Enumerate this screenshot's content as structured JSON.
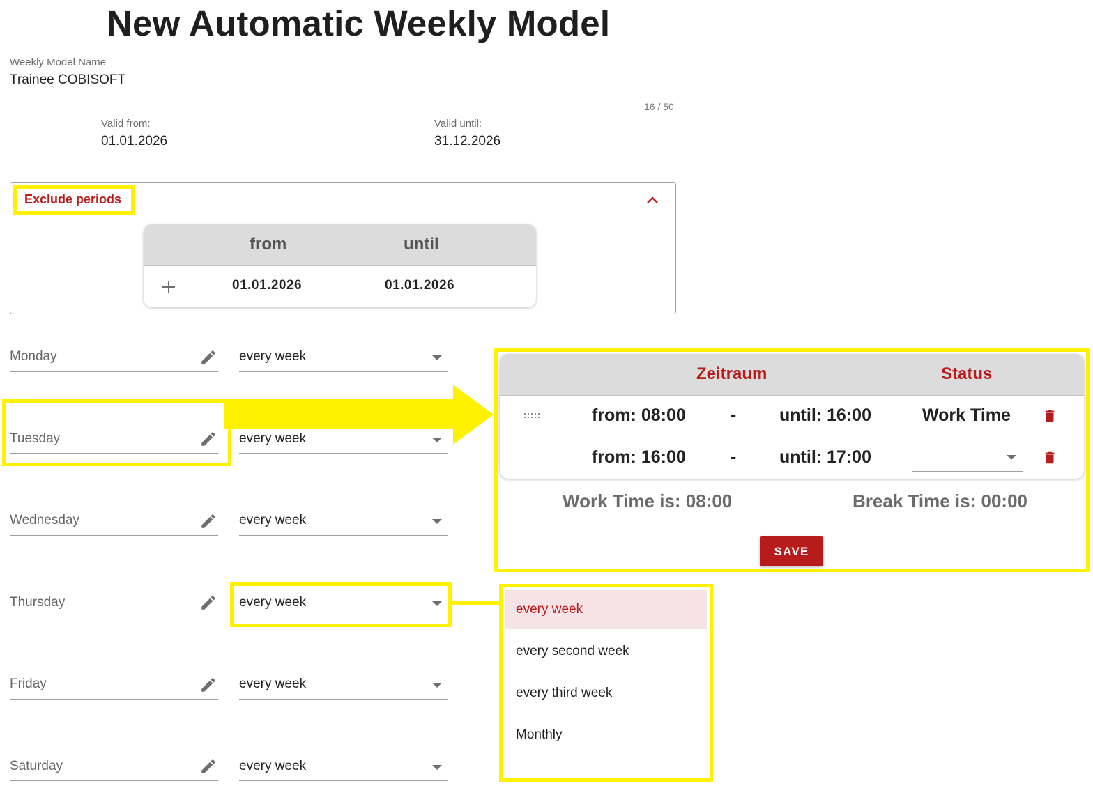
{
  "title": "New Automatic Weekly Model",
  "weekly_model_name": {
    "label": "Weekly Model Name",
    "value": "Trainee COBISOFT",
    "counter": "16 / 50"
  },
  "valid_from": {
    "label": "Valid from:",
    "value": "01.01.2026"
  },
  "valid_until": {
    "label": "Valid until:",
    "value": "31.12.2026"
  },
  "exclude_periods": {
    "title": "Exclude periods",
    "columns": [
      "from",
      "until"
    ],
    "row": {
      "from": "01.01.2026",
      "until": "01.01.2026"
    },
    "icons": {
      "collapse": "chevron-up-icon",
      "add": "plus-icon"
    }
  },
  "days": [
    {
      "name": "Monday",
      "frequency": "every week"
    },
    {
      "name": "Tuesday",
      "frequency": "every week"
    },
    {
      "name": "Wednesday",
      "frequency": "every week"
    },
    {
      "name": "Thursday",
      "frequency": "every week"
    },
    {
      "name": "Friday",
      "frequency": "every week"
    },
    {
      "name": "Saturday",
      "frequency": "every week"
    }
  ],
  "time_panel": {
    "columns": {
      "period": "Zeitraum",
      "status": "Status"
    },
    "rows": [
      {
        "from": "from: 08:00",
        "separator": "-",
        "until": "until: 16:00",
        "status": "Work Time"
      },
      {
        "from": "from: 16:00",
        "separator": "-",
        "until": "until: 17:00",
        "status": ""
      }
    ],
    "work_time": "Work Time is: 08:00",
    "break_time": "Break Time is: 00:00",
    "save_label": "SAVE"
  },
  "frequency_menu": {
    "options": [
      "every week",
      "every second week",
      "every third week",
      "Monthly"
    ],
    "selected": "every week"
  },
  "colors": {
    "accent": "#b71c1c",
    "highlight": "#fff200",
    "header_bg": "#dcdcdc"
  }
}
